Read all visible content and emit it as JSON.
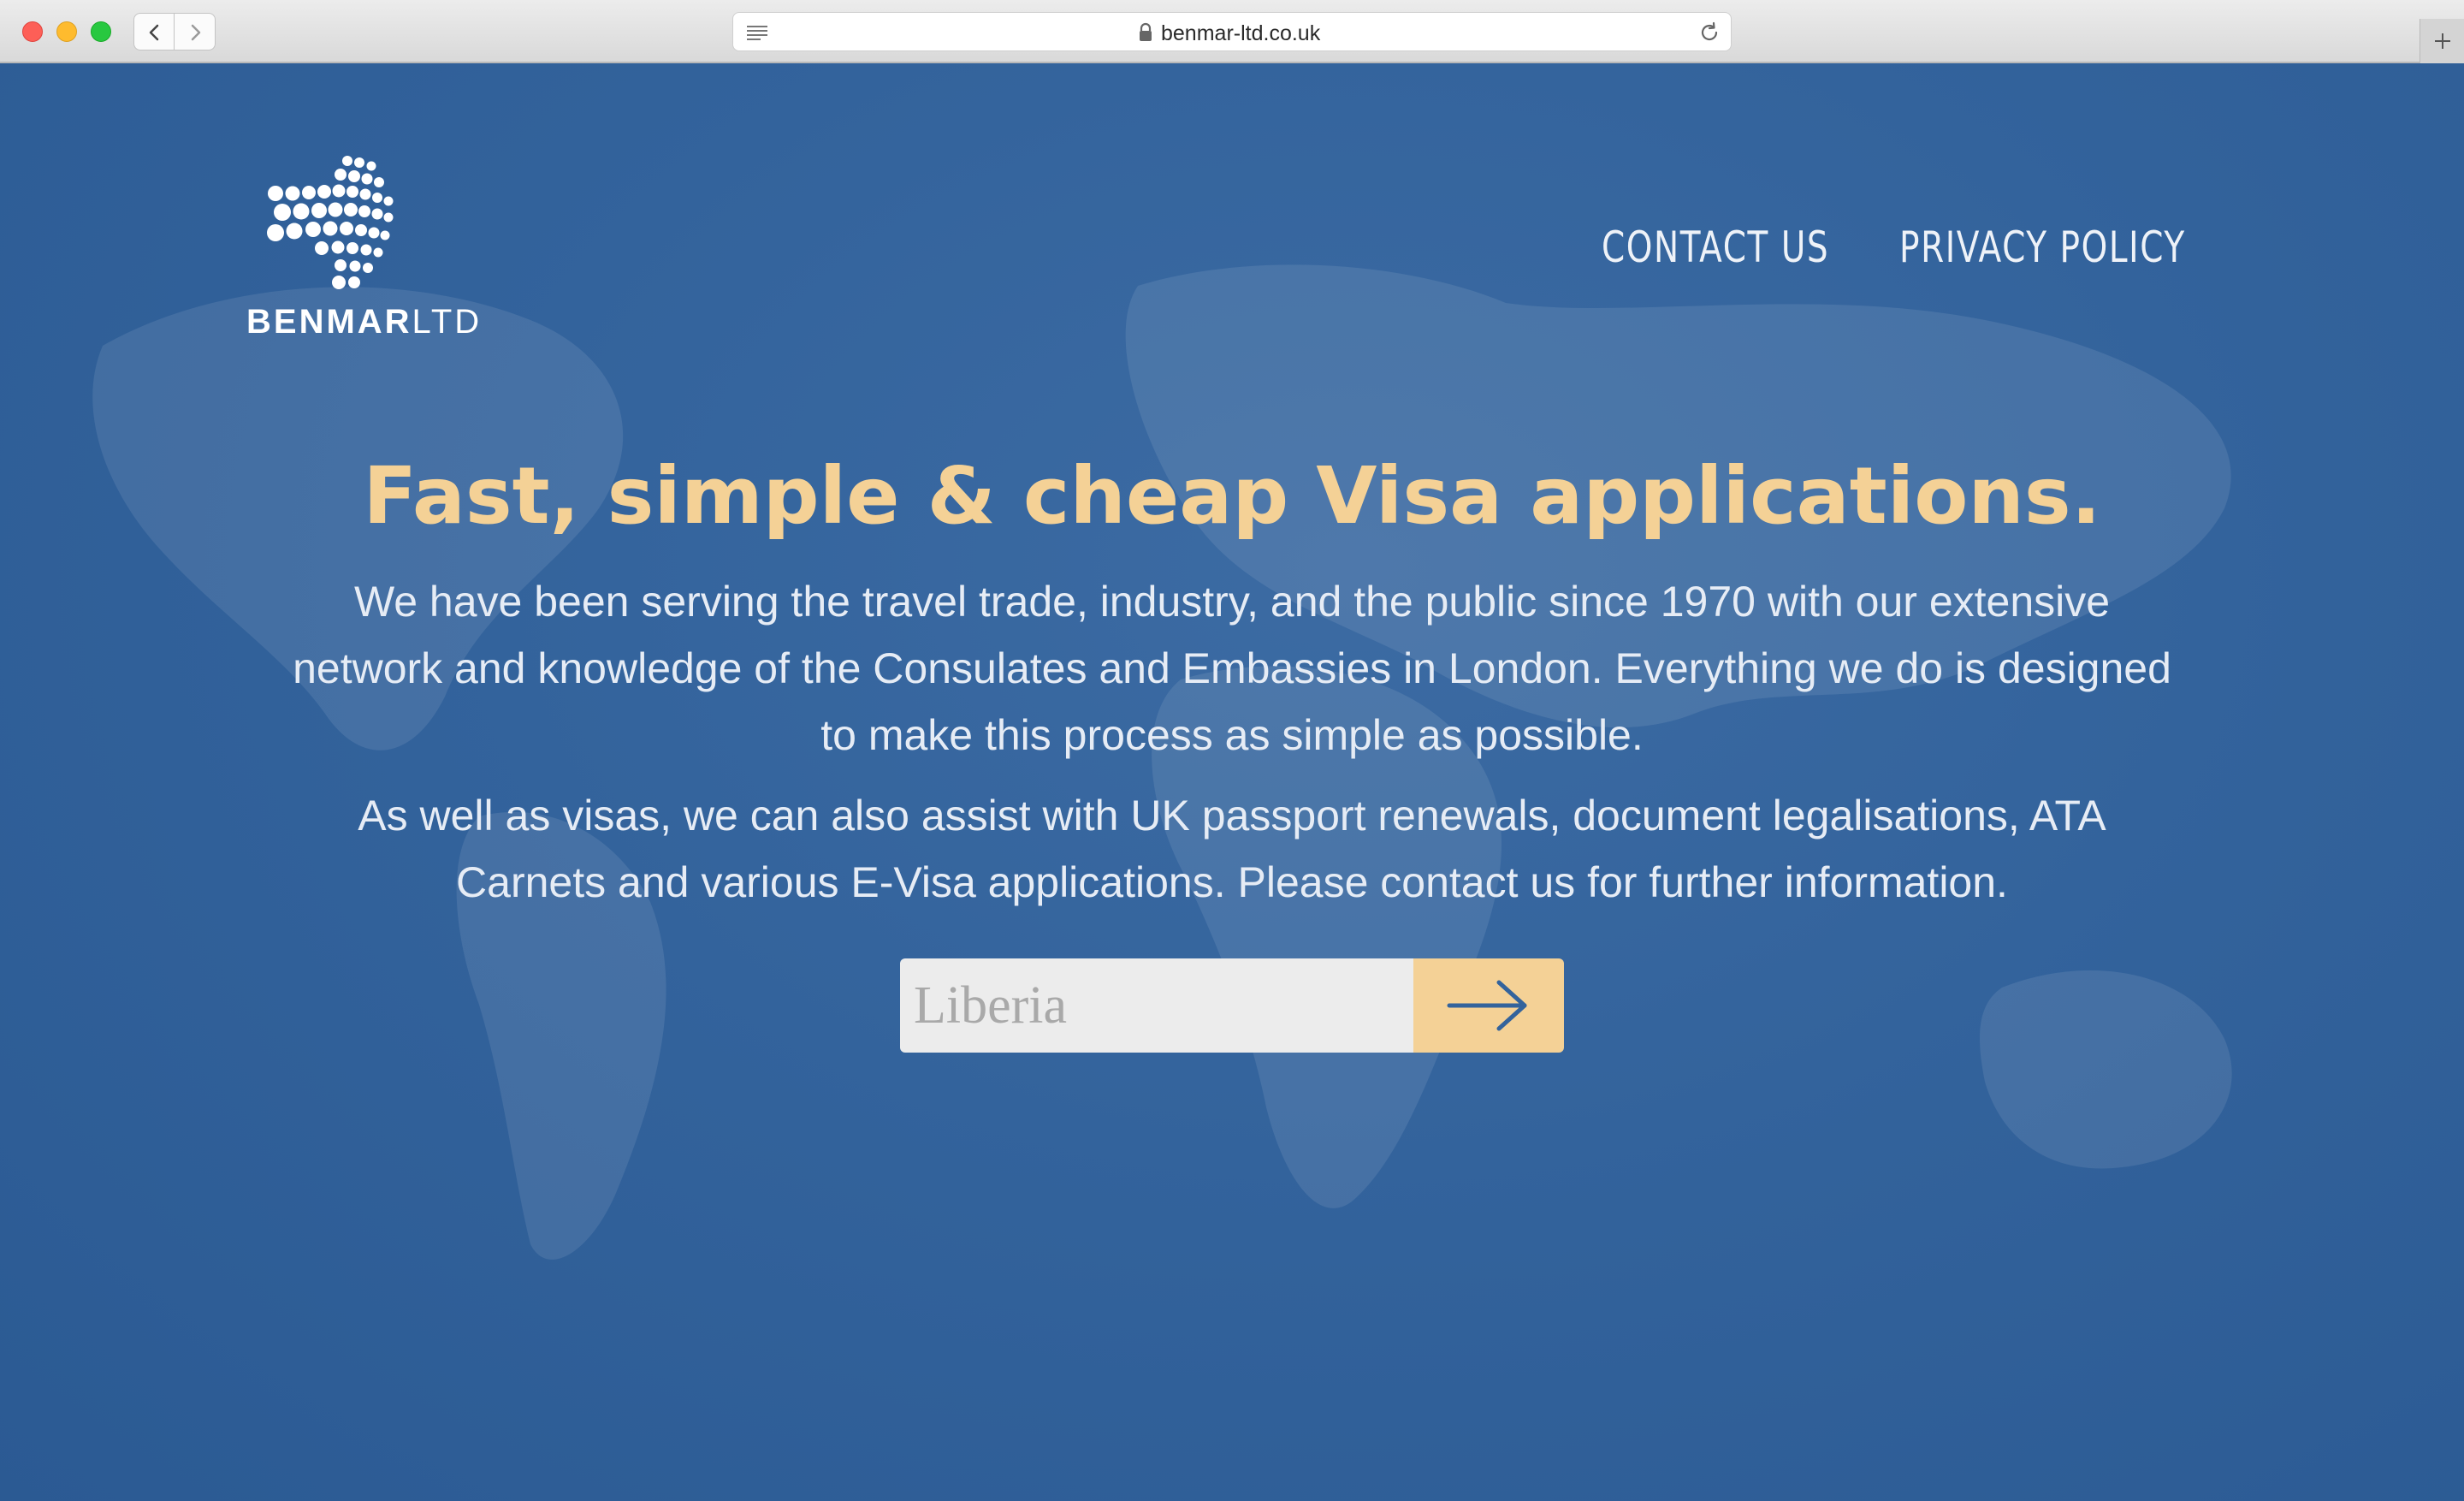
{
  "browser": {
    "url": "benmar-ltd.co.uk"
  },
  "site": {
    "logo_brand_bold": "BENMAR",
    "logo_brand_light": "LTD",
    "nav": {
      "contact": "CONTACT US",
      "privacy": "PRIVACY POLICY"
    },
    "headline": "Fast, simple & cheap Visa applications.",
    "paragraph_1": "We have been serving the travel trade, industry, and the public since 1970 with our extensive network and knowledge of the Consulates and Embassies in London. Everything we do is designed to make this process as simple as possible.",
    "paragraph_2": "As well as visas, we can also assist with UK passport renewals, document legalisations, ATA Carnets and various E-Visa applications. Please contact us for further information.",
    "search": {
      "placeholder": "Liberia"
    }
  },
  "colors": {
    "background": "#33639c",
    "accent": "#f4d196",
    "text": "#e6ecf5",
    "arrow": "#33639c"
  },
  "icons": {
    "back": "chevron-left-icon",
    "forward": "chevron-right-icon",
    "reader": "reader-icon",
    "lock": "lock-icon",
    "reload": "reload-icon",
    "new_tab": "plus-icon",
    "submit": "arrow-right-icon"
  }
}
